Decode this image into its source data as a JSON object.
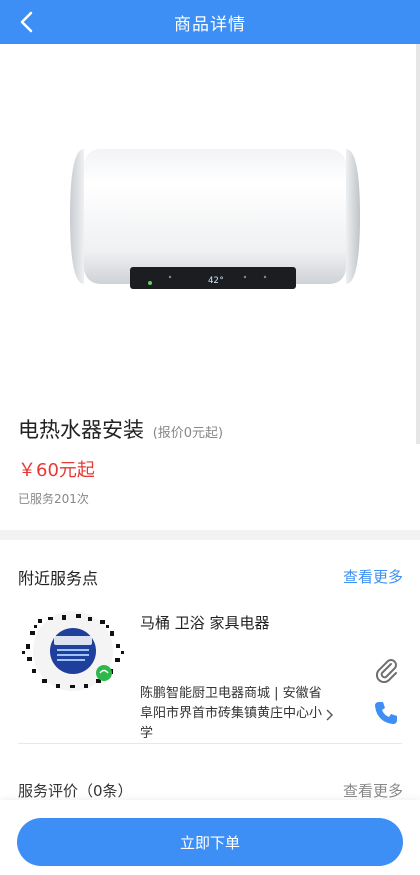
{
  "header": {
    "title": "商品详情"
  },
  "product": {
    "name": "电热水器安装",
    "price_note": "(报价0元起)",
    "price": "￥60元起",
    "served": "已服务201次"
  },
  "nearby": {
    "heading": "附近服务点",
    "more_label": "查看更多",
    "shop": {
      "name": "马桶 卫浴 家具电器",
      "address": "陈鹏智能厨卫电器商城 | 安徽省阜阳市界首市砖集镇黄庄中心小学"
    }
  },
  "reviews": {
    "heading": "服务评价（0条）",
    "more_label": "查看更多"
  },
  "actions": {
    "order_label": "立即下单"
  },
  "colors": {
    "accent": "#3d8ff5",
    "price": "#e53935"
  }
}
